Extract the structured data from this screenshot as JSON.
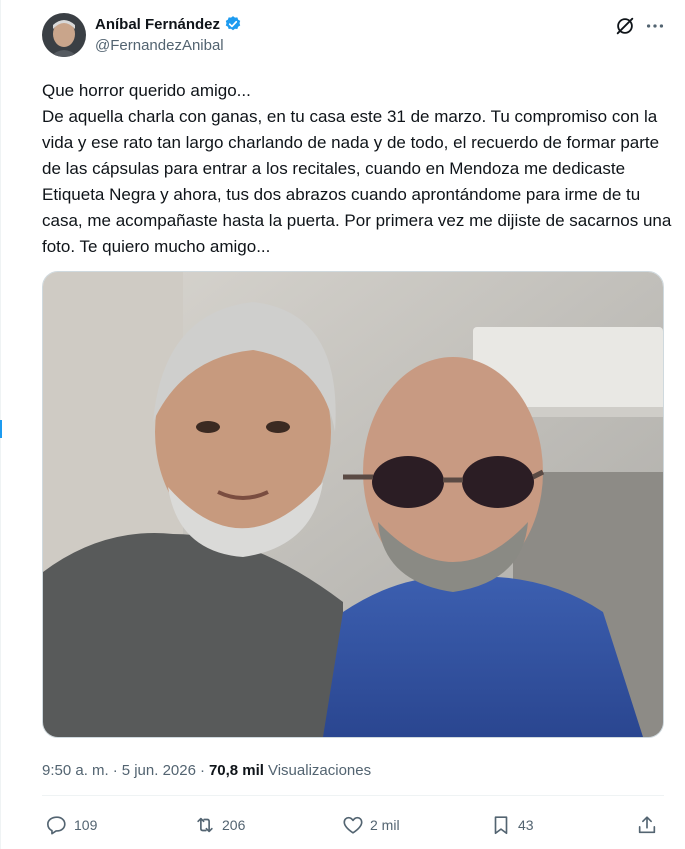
{
  "author": {
    "name": "Aníbal Fernández",
    "handle": "@FernandezAnibal",
    "verified": true
  },
  "post": {
    "text": "Que horror querido amigo...\nDe aquella charla con ganas, en tu casa este 31 de marzo. Tu compromiso con la vida y ese rato tan largo charlando de nada y de todo, el recuerdo de formar parte de las cápsulas para entrar a los recitales, cuando en Mendoza me dedicaste Etiqueta Negra y ahora, tus dos abrazos cuando aprontándome para irme de tu casa, me acompañaste hasta la puerta. Por primera vez me dijiste de sacarnos una foto. Te quiero mucho amigo..."
  },
  "meta": {
    "time": "9:50 a. m.",
    "separator1": "·",
    "date": "5 jun. 2026",
    "separator2": "·",
    "views_count": "70,8 mil",
    "views_label": "Visualizaciones"
  },
  "actions": {
    "replies": "109",
    "reposts": "206",
    "likes": "2 mil",
    "bookmarks": "43"
  },
  "icons": {
    "grok": "grok-icon",
    "more": "more-icon",
    "reply": "reply-icon",
    "repost": "repost-icon",
    "like": "like-icon",
    "bookmark": "bookmark-icon",
    "share": "share-icon"
  },
  "colors": {
    "text": "#0f1419",
    "secondary": "#536471",
    "verified": "#1d9bf0",
    "border": "#cfd9de"
  }
}
